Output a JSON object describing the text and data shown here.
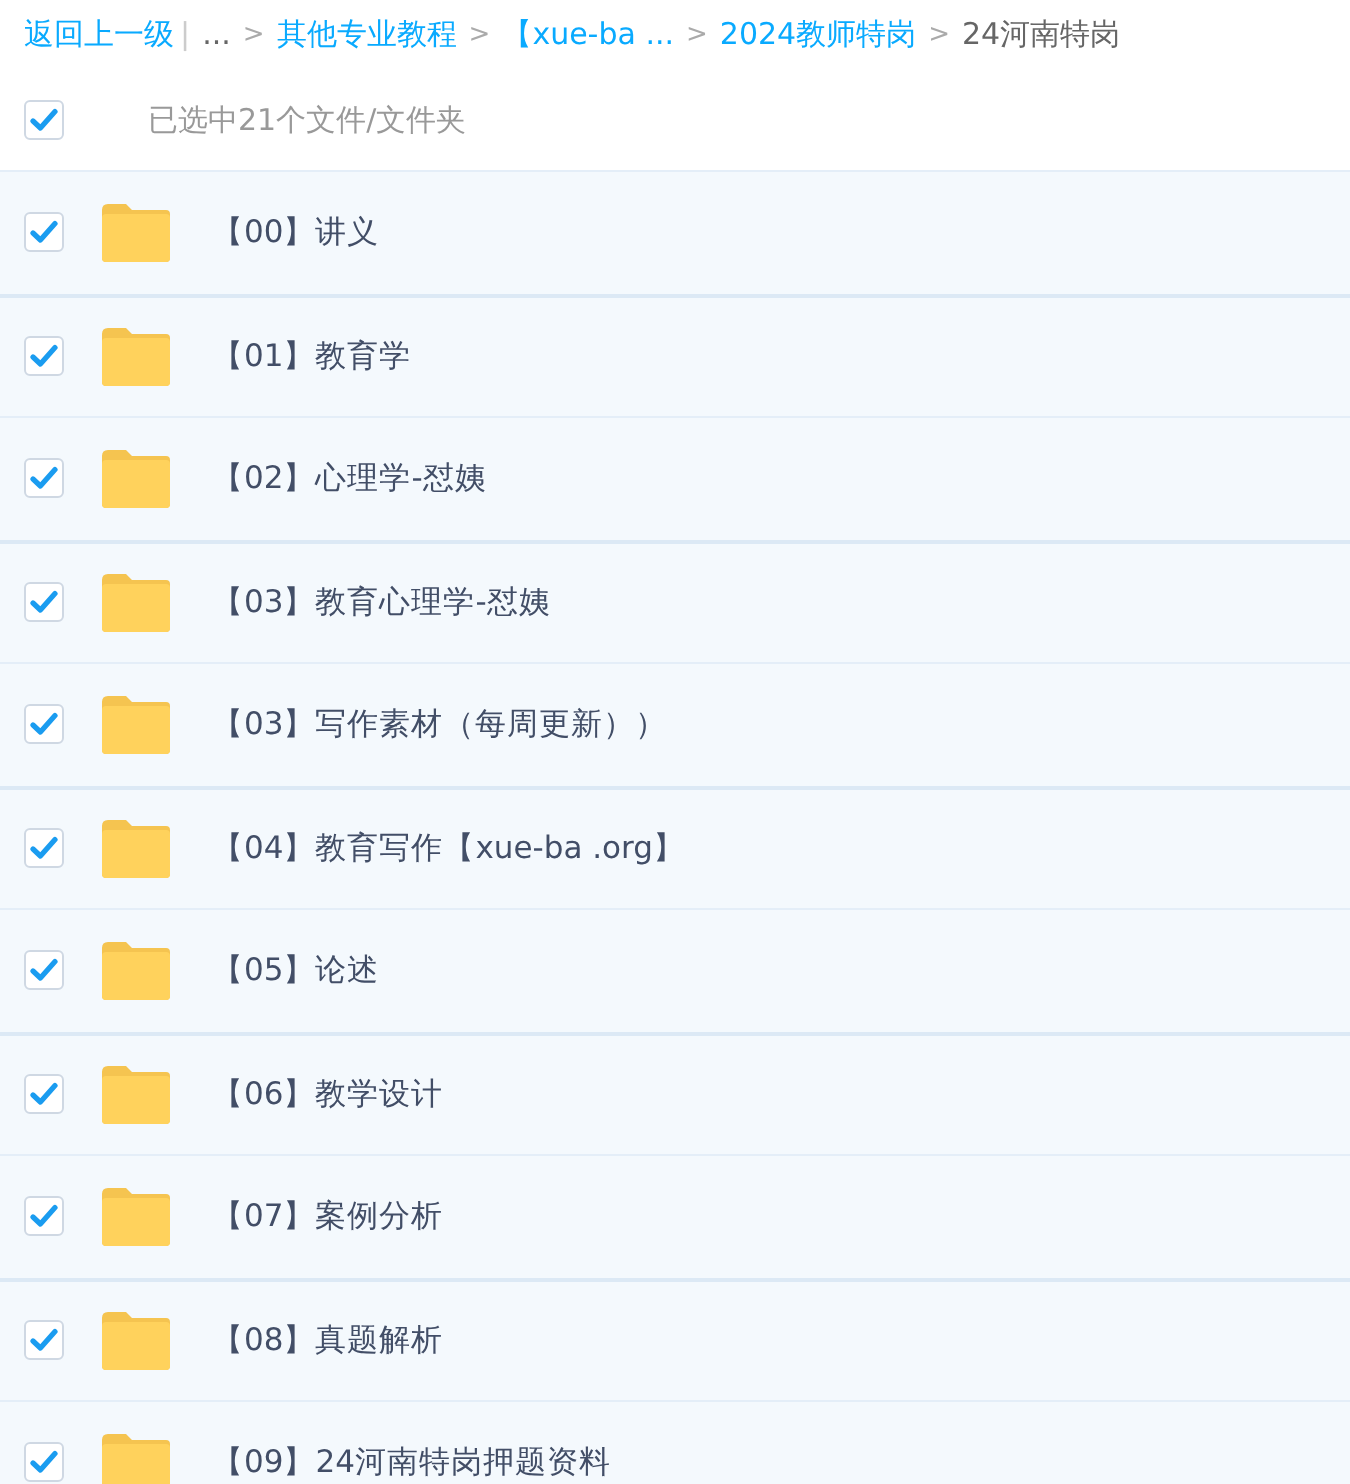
{
  "breadcrumb": [
    {
      "kind": "link",
      "text": "返回上一级"
    },
    {
      "kind": "divider",
      "text": "|"
    },
    {
      "kind": "ellipsis",
      "text": "..."
    },
    {
      "kind": "separator",
      "text": ">"
    },
    {
      "kind": "link",
      "text": "其他专业教程"
    },
    {
      "kind": "separator",
      "text": ">"
    },
    {
      "kind": "link",
      "text": "【xue-ba ..."
    },
    {
      "kind": "separator",
      "text": ">"
    },
    {
      "kind": "link",
      "text": "2024教师特岗"
    },
    {
      "kind": "separator",
      "text": ">"
    },
    {
      "kind": "current",
      "text": "24河南特岗"
    }
  ],
  "select_all": {
    "checked": true,
    "label": "已选中21个文件/文件夹"
  },
  "files": [
    {
      "name": "【00】讲义",
      "checked": true
    },
    {
      "name": "【01】教育学",
      "checked": true
    },
    {
      "name": "【02】心理学-怼姨",
      "checked": true
    },
    {
      "name": "【03】教育心理学-怼姨",
      "checked": true
    },
    {
      "name": "【03】写作素材（每周更新））",
      "checked": true
    },
    {
      "name": "【04】教育写作【xue-ba .org】",
      "checked": true
    },
    {
      "name": "【05】论述",
      "checked": true
    },
    {
      "name": "【06】教学设计",
      "checked": true
    },
    {
      "name": "【07】案例分析",
      "checked": true
    },
    {
      "name": "【08】真题解析",
      "checked": true
    },
    {
      "name": "【09】24河南特岗押题资料",
      "checked": true
    }
  ]
}
